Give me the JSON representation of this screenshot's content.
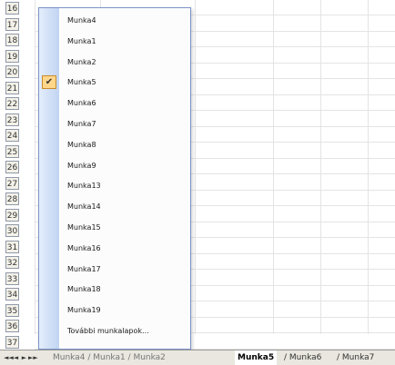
{
  "rows": [
    "16",
    "17",
    "18",
    "19",
    "20",
    "21",
    "22",
    "23",
    "24",
    "25",
    "26",
    "27",
    "28",
    "29",
    "30",
    "31",
    "32",
    "33",
    "34",
    "35",
    "36",
    "37"
  ],
  "menu": {
    "items": [
      {
        "label": "Munka4",
        "checked": false
      },
      {
        "label": "Munka1",
        "checked": false
      },
      {
        "label": "Munka2",
        "checked": false
      },
      {
        "label": "Munka5",
        "checked": true
      },
      {
        "label": "Munka6",
        "checked": false
      },
      {
        "label": "Munka7",
        "checked": false
      },
      {
        "label": "Munka8",
        "checked": false
      },
      {
        "label": "Munka9",
        "checked": false
      },
      {
        "label": "Munka13",
        "checked": false
      },
      {
        "label": "Munka14",
        "checked": false
      },
      {
        "label": "Munka15",
        "checked": false
      },
      {
        "label": "Munka16",
        "checked": false
      },
      {
        "label": "Munka17",
        "checked": false
      },
      {
        "label": "Munka18",
        "checked": false
      },
      {
        "label": "Munka19",
        "checked": false
      },
      {
        "label": "További munkalapok...",
        "checked": false
      }
    ],
    "check_mark": "✔"
  },
  "tabbar": {
    "nav_buttons": [
      "◄◄",
      "◄",
      "►",
      "►►"
    ],
    "tabs": [
      {
        "label": "Munka4 / Munka1 / Munka2",
        "active": false
      },
      {
        "label": "Munka5",
        "active": true
      },
      {
        "label": "/ Munka6",
        "active": false
      },
      {
        "label": "/ Munka7",
        "active": false
      }
    ]
  },
  "colors": {
    "menu_border": "#7b93c4",
    "check_bg": "#ffd68a",
    "tab_bar_bg": "#e9e7df"
  }
}
